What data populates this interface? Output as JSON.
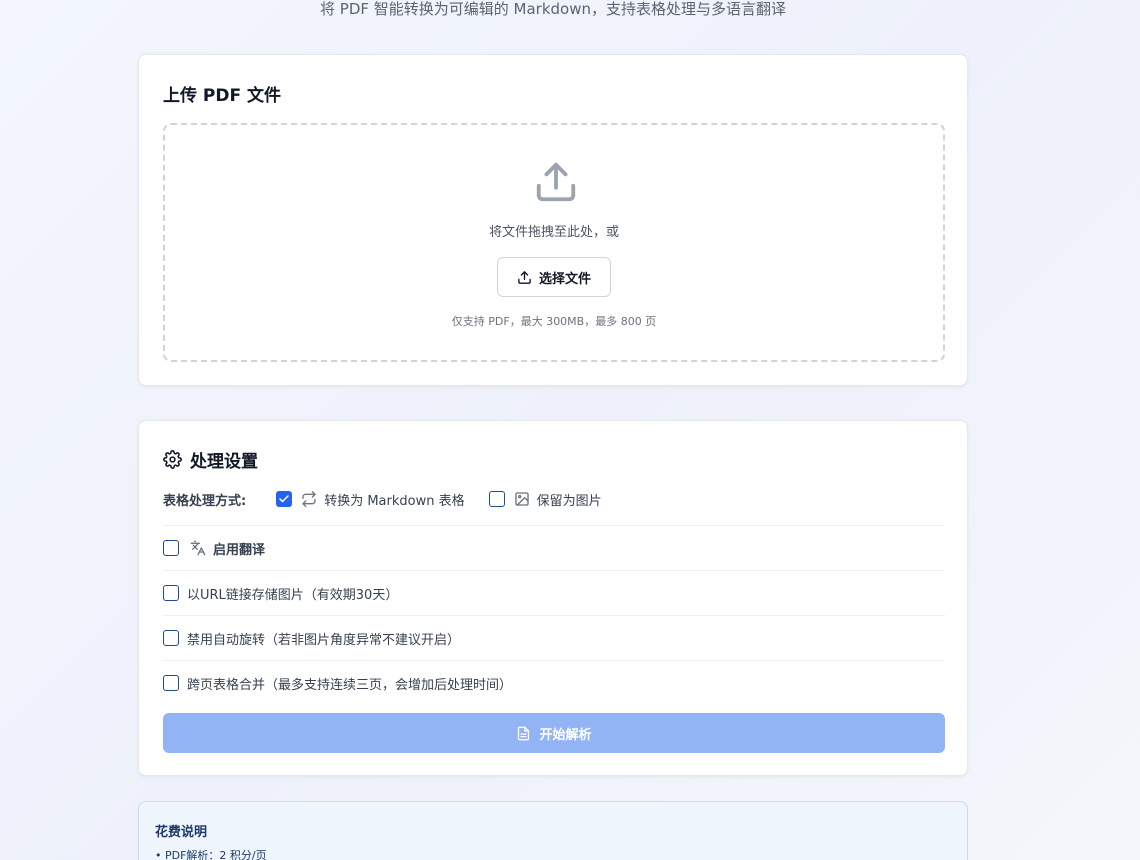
{
  "header": {
    "subtitle": "将 PDF 智能转换为可编辑的 Markdown，支持表格处理与多语言翻译"
  },
  "upload": {
    "title": "上传 PDF 文件",
    "drop_text": "将文件拖拽至此处，或",
    "choose_button": "选择文件",
    "hint": "仅支持 PDF，最大 300MB，最多 800 页",
    "icon": "upload-icon"
  },
  "settings": {
    "title": "处理设置",
    "icon": "gear-icon",
    "table_mode": {
      "label": "表格处理方式:",
      "options": [
        {
          "label": "转换为 Markdown 表格",
          "checked": true,
          "icon": "repeat-icon"
        },
        {
          "label": "保留为图片",
          "checked": false,
          "icon": "image-icon"
        }
      ]
    },
    "options": [
      {
        "label": "启用翻译",
        "checked": false,
        "icon": "translate-icon"
      },
      {
        "label": "以URL链接存储图片（有效期30天）",
        "checked": false
      },
      {
        "label": "禁用自动旋转（若非图片角度异常不建议开启）",
        "checked": false
      },
      {
        "label": "跨页表格合并（最多支持连续三页，会增加后处理时间）",
        "checked": false
      }
    ],
    "start_button": "开始解析"
  },
  "cost": {
    "title": "花费说明",
    "items": [
      "• PDF解析：2 积分/页"
    ]
  },
  "colors": {
    "accent": "#2563eb",
    "button_disabled": "#93b4f4",
    "cost_background": "#eef5fd"
  }
}
